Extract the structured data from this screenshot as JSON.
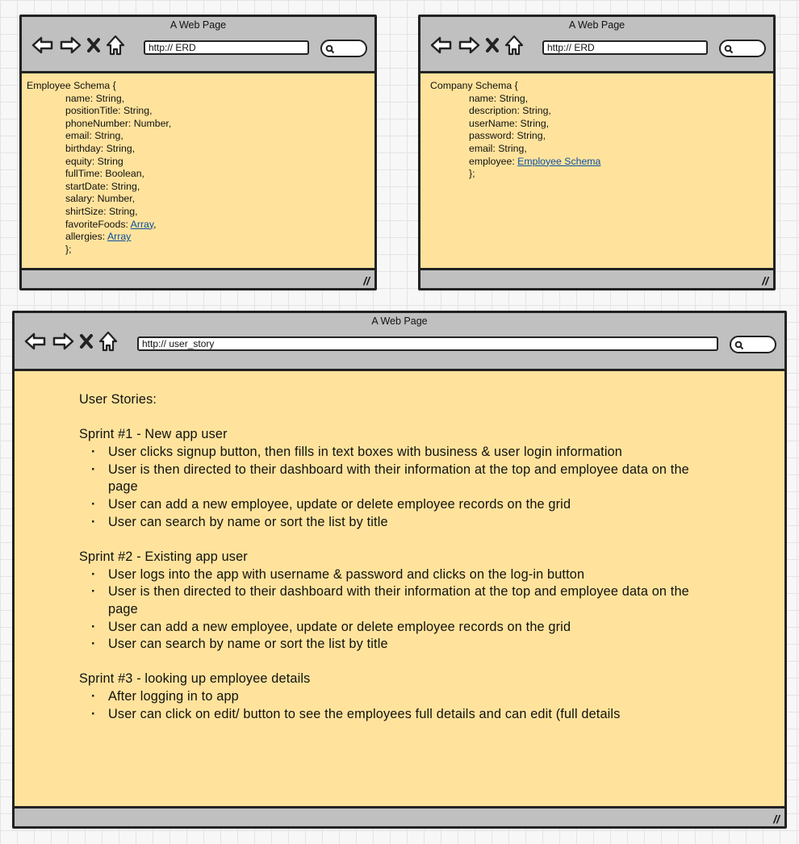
{
  "windows": {
    "employee": {
      "title": "A Web Page",
      "url": "http:// ERD",
      "header": "Employee Schema {",
      "fields": [
        {
          "text": "name: String,"
        },
        {
          "text": "positionTitle: String,"
        },
        {
          "text": "phoneNumber: Number,"
        },
        {
          "text": "email: String,"
        },
        {
          "text": "birthday: String,"
        },
        {
          "text": "equity: String"
        },
        {
          "text": "fullTime: Boolean,"
        },
        {
          "text": "startDate: String,"
        },
        {
          "text": "salary: Number,"
        },
        {
          "text": "shirtSize: String,"
        },
        {
          "text": "favoriteFoods: ",
          "link": "Array",
          "suffix": ","
        },
        {
          "text": "allergies: ",
          "link": "Array"
        },
        {
          "text": "};"
        }
      ]
    },
    "company": {
      "title": "A Web Page",
      "url": "http:// ERD",
      "header": "Company Schema {",
      "fields": [
        {
          "text": "name: String,"
        },
        {
          "text": "description: String,"
        },
        {
          "text": "userName: String,"
        },
        {
          "text": "password: String,"
        },
        {
          "text": "email: String,"
        },
        {
          "text": "employee: ",
          "link": "Employee Schema"
        },
        {
          "text": "};"
        }
      ]
    },
    "stories": {
      "title": "A Web Page",
      "url": "http:// user_story",
      "heading": "User Stories:",
      "sprints": [
        {
          "title": "Sprint #1 - New app user",
          "items": [
            "User clicks signup button, then fills in text boxes with business & user login information",
            "User is then directed to their dashboard with their information at the top and employee data on the page",
            "User can add a new employee, update or delete employee records on the grid",
            "User can search by name or sort the list by title"
          ]
        },
        {
          "title": "Sprint #2 - Existing app user",
          "items": [
            "User logs into the app with username & password and clicks on the log-in button",
            "User is then directed to their dashboard with their information at the top and employee data on the page",
            "User can add a new employee, update or delete employee records on the grid",
            "User can search by name or sort the list by title"
          ]
        },
        {
          "title": "Sprint #3 - looking up employee details",
          "items": [
            "After logging in to app",
            "User can click on edit/ button to see the employees full details and can edit (full details"
          ]
        }
      ]
    }
  },
  "colors": {
    "content_bg": "#ffe39c",
    "chrome": "#c0c0c0",
    "link": "#0b4ea2"
  }
}
